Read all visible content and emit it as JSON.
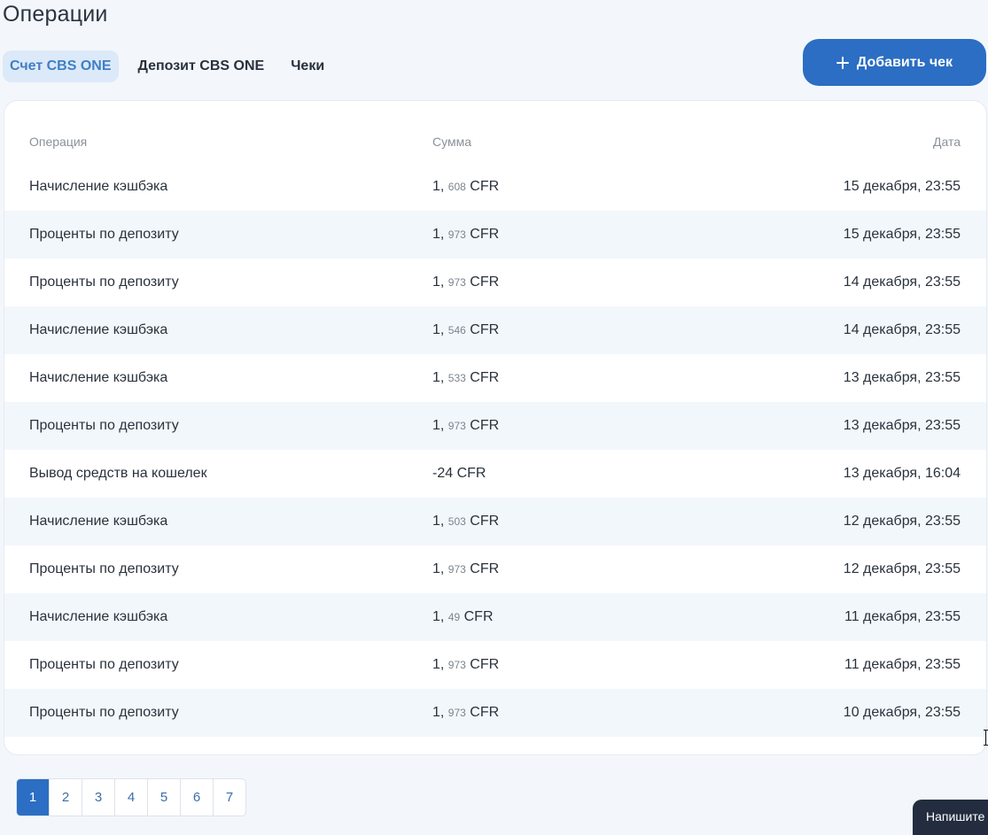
{
  "page": {
    "title": "Операции"
  },
  "tabs": [
    {
      "label": "Счет CBS ONE",
      "active": true
    },
    {
      "label": "Депозит CBS ONE",
      "active": false
    },
    {
      "label": "Чеки",
      "active": false
    }
  ],
  "actions": {
    "add_check_label": "Добавить чек",
    "add_check_icon": "plus-icon"
  },
  "table": {
    "headers": {
      "operation": "Операция",
      "amount": "Сумма",
      "date": "Дата"
    },
    "rows": [
      {
        "operation": "Начисление кэшбэка",
        "amount_int": "1,",
        "amount_frac": "608",
        "currency": "CFR",
        "date": "15 декабря, 23:55"
      },
      {
        "operation": "Проценты по депозиту",
        "amount_int": "1,",
        "amount_frac": "973",
        "currency": "CFR",
        "date": "15 декабря, 23:55"
      },
      {
        "operation": "Проценты по депозиту",
        "amount_int": "1,",
        "amount_frac": "973",
        "currency": "CFR",
        "date": "14 декабря, 23:55"
      },
      {
        "operation": "Начисление кэшбэка",
        "amount_int": "1,",
        "amount_frac": "546",
        "currency": "CFR",
        "date": "14 декабря, 23:55"
      },
      {
        "operation": "Начисление кэшбэка",
        "amount_int": "1,",
        "amount_frac": "533",
        "currency": "CFR",
        "date": "13 декабря, 23:55"
      },
      {
        "operation": "Проценты по депозиту",
        "amount_int": "1,",
        "amount_frac": "973",
        "currency": "CFR",
        "date": "13 декабря, 23:55"
      },
      {
        "operation": "Вывод средств на кошелек",
        "amount_int": "-24",
        "amount_frac": "",
        "currency": "CFR",
        "date": "13 декабря, 16:04"
      },
      {
        "operation": "Начисление кэшбэка",
        "amount_int": "1,",
        "amount_frac": "503",
        "currency": "CFR",
        "date": "12 декабря, 23:55"
      },
      {
        "operation": "Проценты по депозиту",
        "amount_int": "1,",
        "amount_frac": "973",
        "currency": "CFR",
        "date": "12 декабря, 23:55"
      },
      {
        "operation": "Начисление кэшбэка",
        "amount_int": "1,",
        "amount_frac": "49",
        "currency": "CFR",
        "date": "11 декабря, 23:55"
      },
      {
        "operation": "Проценты по депозиту",
        "amount_int": "1,",
        "amount_frac": "973",
        "currency": "CFR",
        "date": "11 декабря, 23:55"
      },
      {
        "operation": "Проценты по депозиту",
        "amount_int": "1,",
        "amount_frac": "973",
        "currency": "CFR",
        "date": "10 декабря, 23:55"
      }
    ]
  },
  "pagination": {
    "pages": [
      "1",
      "2",
      "3",
      "4",
      "5",
      "6",
      "7"
    ],
    "current": "1"
  },
  "chat_widget": {
    "label": "Напишите"
  },
  "colors": {
    "accent": "#2b6ec3",
    "active_tab_bg": "#dce9f8",
    "active_tab_text": "#3e7fc6",
    "page_bg": "#f3f7fb",
    "row_stripe": "#f2f7fc",
    "chat_widget_bg": "#232d3f"
  }
}
